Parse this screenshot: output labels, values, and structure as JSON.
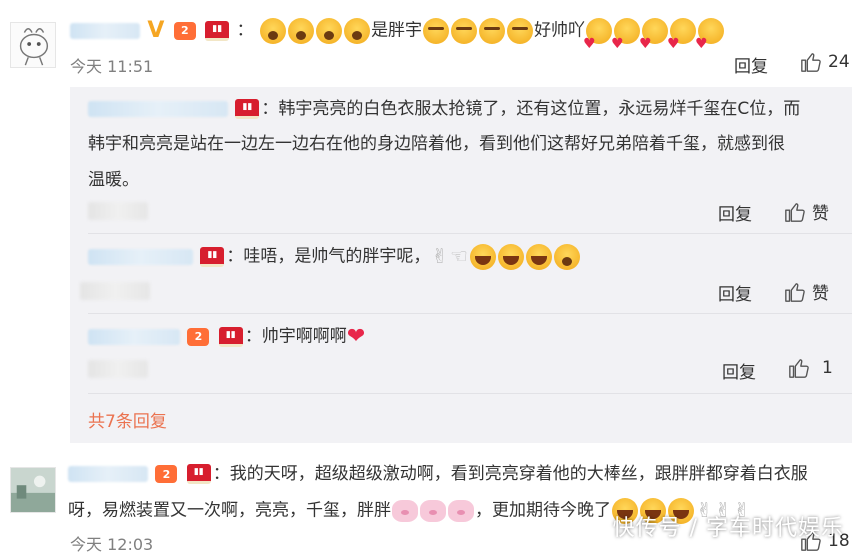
{
  "comments": [
    {
      "text_1": "是胖宇",
      "text_2": "好帅吖",
      "time": "今天 11:51",
      "reply_label": "回复",
      "like_count": "24",
      "replies": [
        {
          "text_line1": "：韩宇亮亮的白色衣服太抢镜了，还有这位置，永远易烊千玺在C位，而",
          "text_line2": "韩宇和亮亮是站在一边左一边右在他的身边陪着他，看到他们这帮好兄弟陪着千玺，就感到很",
          "text_line3": "温暖。",
          "reply_label": "回复",
          "like_label": "赞"
        },
        {
          "text": "：哇唔，是帅气的胖宇呢，",
          "reply_label": "回复",
          "like_label": "赞"
        },
        {
          "text": "：帅宇啊啊啊",
          "reply_label": "回复",
          "like_count": "1"
        }
      ],
      "more_replies": "共7条回复"
    },
    {
      "text_line1": "：我的天呀，超级超级激动啊，看到亮亮穿着他的大棒丝，跟胖胖都穿着白衣服",
      "text_line2a": "呀，易燃装置又一次啊，亮亮，千玺，胖胖",
      "text_line2b": "，更加期待今晚了",
      "time": "今天 12:03",
      "like_count": "18"
    }
  ],
  "colon": "：",
  "watermark": "快传号 / 字车时代娱乐",
  "colors": {
    "accent_link": "#eb7350",
    "reply_background": "#f2f2f5",
    "timestamp": "#808080",
    "level_badge": "#ff6e37",
    "vip_badge": "#d71e2e"
  },
  "icons": [
    "thumbs-up-icon",
    "v-verified-icon",
    "level-badge-icon",
    "vip-badge-icon"
  ]
}
